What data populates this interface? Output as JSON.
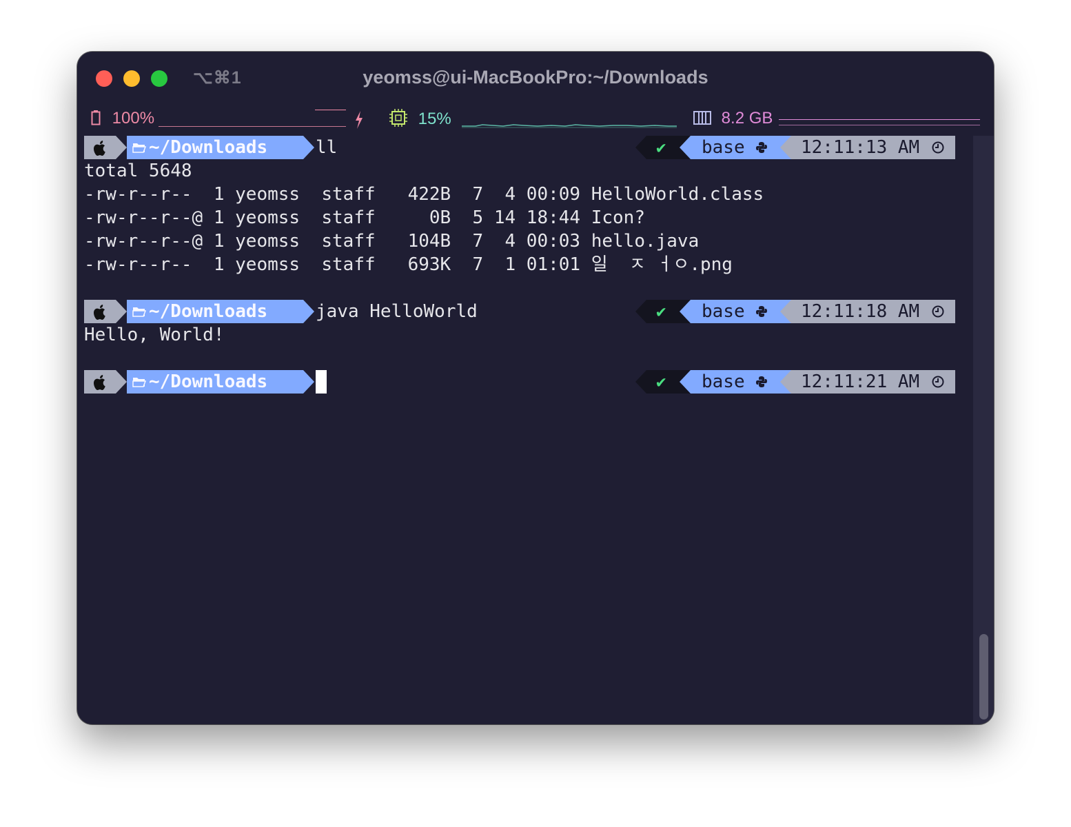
{
  "window": {
    "title": "yeomss@ui-MacBookPro:~/Downloads",
    "shortcut": "⌥⌘1"
  },
  "statusbar": {
    "battery": "100%",
    "cpu": "15%",
    "memory": "8.2 GB",
    "colors": {
      "battery": "#ee8aa6",
      "cpu": "#7fe3cd",
      "memory": "#e08bd8"
    }
  },
  "prompt": {
    "dir": "~/Downloads",
    "env": "base",
    "icons": [
      "apple-icon",
      "folder-icon",
      "check-icon",
      "python-icon",
      "clock-icon"
    ]
  },
  "session": {
    "cmd1": "ll",
    "time1": "12:11:13 AM",
    "listing": [
      "total 5648",
      "-rw-r--r--  1 yeomss  staff   422B  7  4 00:09 HelloWorld.class",
      "-rw-r--r--@ 1 yeomss  staff     0B  5 14 18:44 Icon?",
      "-rw-r--r--@ 1 yeomss  staff   104B  7  4 00:03 hello.java",
      "-rw-r--r--  1 yeomss  staff   693K  7  1 01:01 일  ㅈ ㅓㅇ.png"
    ],
    "cmd2": "java HelloWorld",
    "time2": "12:11:18 AM",
    "output2": "Hello, World!",
    "time3": "12:11:21 AM"
  }
}
